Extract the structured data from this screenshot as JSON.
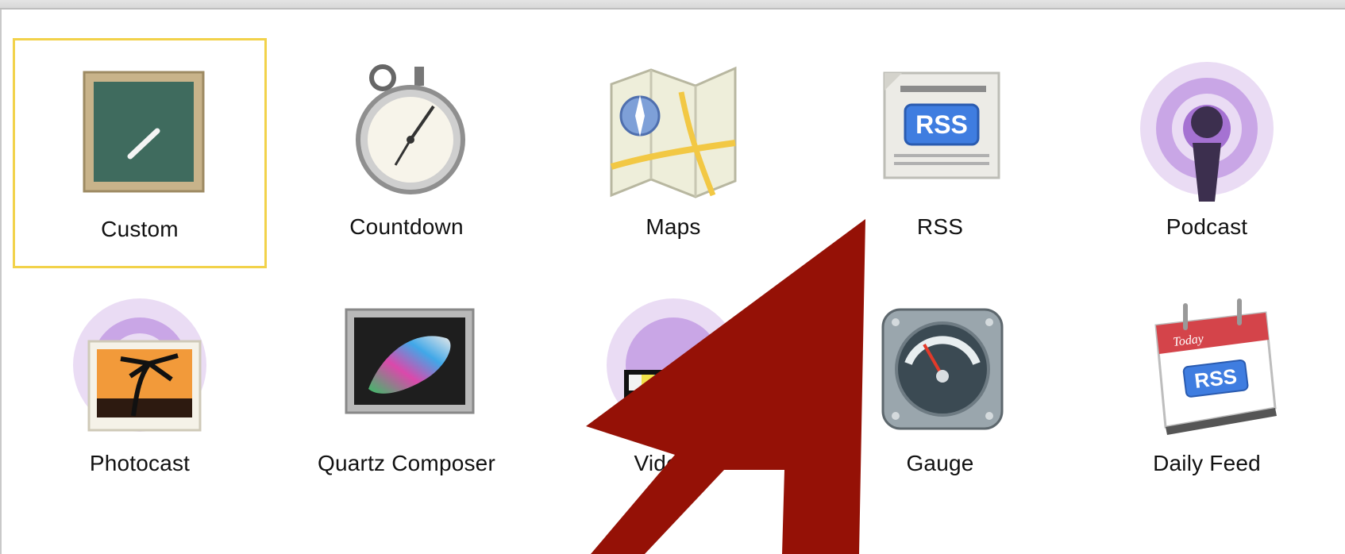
{
  "window": {
    "title": ""
  },
  "templates": [
    {
      "id": "custom",
      "label": "Custom",
      "icon": "chalkboard-icon",
      "selected": true
    },
    {
      "id": "countdown",
      "label": "Countdown",
      "icon": "stopwatch-icon",
      "selected": false
    },
    {
      "id": "maps",
      "label": "Maps",
      "icon": "map-icon",
      "selected": false
    },
    {
      "id": "rss",
      "label": "RSS",
      "icon": "rss-newspaper-icon",
      "selected": false
    },
    {
      "id": "podcast",
      "label": "Podcast",
      "icon": "podcast-icon",
      "selected": false
    },
    {
      "id": "photocast",
      "label": "Photocast",
      "icon": "photocast-icon",
      "selected": false
    },
    {
      "id": "quartz",
      "label": "Quartz Composer",
      "icon": "quartz-composer-icon",
      "selected": false
    },
    {
      "id": "video",
      "label": "Video P",
      "icon": "video-podcast-icon",
      "selected": false
    },
    {
      "id": "gauge",
      "label": "Gauge",
      "icon": "gauge-icon",
      "selected": false
    },
    {
      "id": "dailyfeed",
      "label": "Daily Feed",
      "icon": "daily-feed-icon",
      "selected": false
    }
  ],
  "icon_text": {
    "rss": "RSS",
    "daily_rss": "RSS",
    "today": "Today"
  },
  "colors": {
    "selection": "#f2d24a",
    "annotation_arrow": "#951106"
  }
}
